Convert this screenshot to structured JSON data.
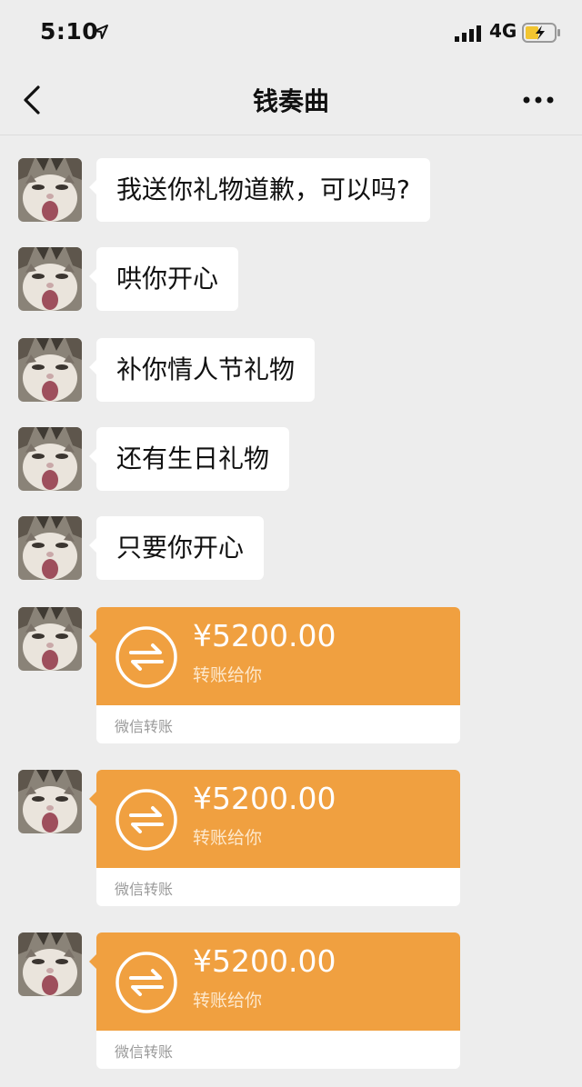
{
  "status_bar": {
    "time": "5:10",
    "network": "4G",
    "icons": [
      "location-arrow-icon",
      "signal-icon",
      "battery-charging-icon"
    ]
  },
  "nav": {
    "title": "钱奏曲",
    "back_icon": "chevron-left-icon",
    "more_icon": "more-dots-icon"
  },
  "messages": [
    {
      "type": "text",
      "text": "我送你礼物道歉，可以吗?"
    },
    {
      "type": "text",
      "text": "哄你开心"
    },
    {
      "type": "text",
      "text": "补你情人节礼物"
    },
    {
      "type": "text",
      "text": "还有生日礼物"
    },
    {
      "type": "text",
      "text": "只要你开心"
    },
    {
      "type": "transfer",
      "amount": "¥5200.00",
      "desc": "转账给你",
      "source": "微信转账"
    },
    {
      "type": "transfer",
      "amount": "¥5200.00",
      "desc": "转账给你",
      "source": "微信转账"
    },
    {
      "type": "transfer",
      "amount": "¥5200.00",
      "desc": "转账给你",
      "source": "微信转账"
    }
  ],
  "colors": {
    "background": "#ededed",
    "bubble": "#ffffff",
    "transfer_orange": "#f0a040"
  }
}
